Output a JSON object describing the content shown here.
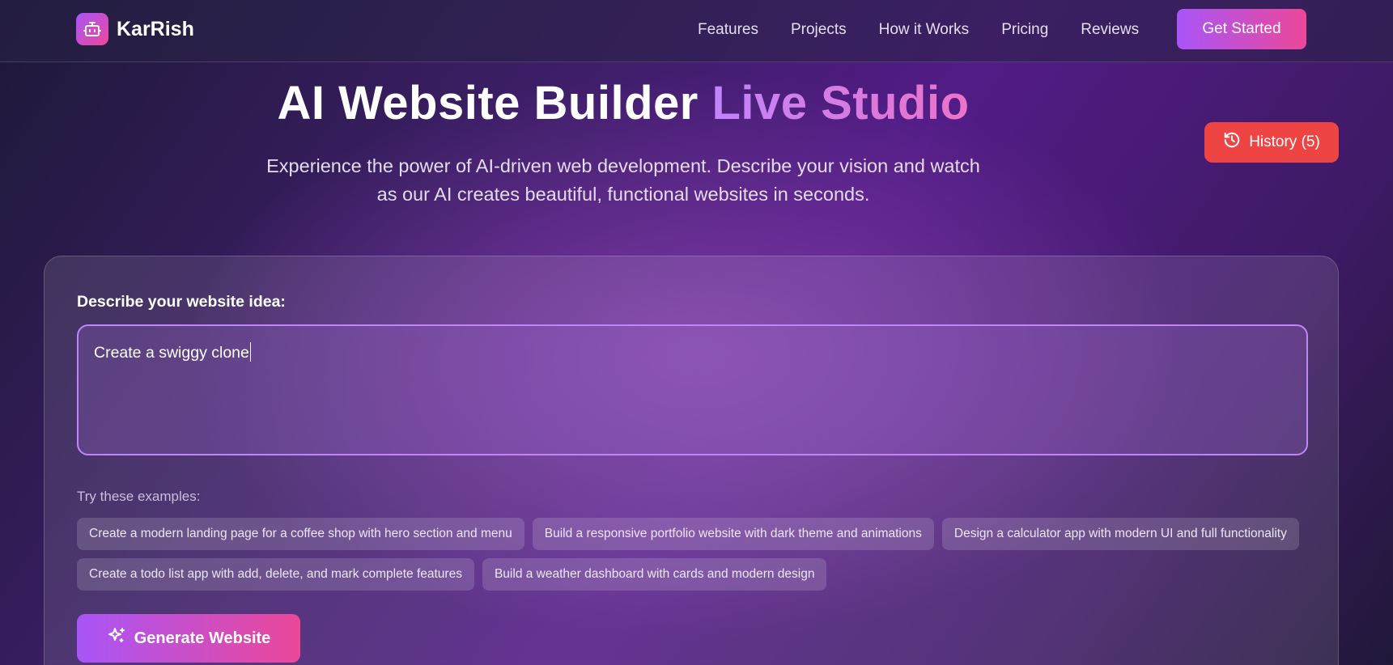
{
  "brand": {
    "name": "KarRish",
    "icon": "robot-icon"
  },
  "nav": {
    "links": [
      "Features",
      "Projects",
      "How it Works",
      "Pricing",
      "Reviews"
    ],
    "cta_label": "Get Started"
  },
  "hero": {
    "title_main": "AI Website Builder",
    "title_accent": "Live Studio",
    "subtitle_line1": "Experience the power of AI-driven web development. Describe your vision and watch",
    "subtitle_line2": "as our AI creates beautiful, functional websites in seconds."
  },
  "history": {
    "label": "History (5)",
    "icon": "history-icon"
  },
  "builder": {
    "prompt_label": "Describe your website idea:",
    "prompt_value": "Create a swiggy clone",
    "examples_label": "Try these examples:",
    "examples": [
      "Create a modern landing page for a coffee shop with hero section and menu",
      "Build a responsive portfolio website with dark theme and animations",
      "Design a calculator app with modern UI and full functionality",
      "Create a todo list app with add, delete, and mark complete features",
      "Build a weather dashboard with cards and modern design"
    ],
    "generate_label": "Generate Website",
    "generate_icon": "sparkles-icon"
  },
  "colors": {
    "accent_start": "#a855f7",
    "accent_end": "#ec4899",
    "history_button": "#ef4444",
    "prompt_border": "#c084fc"
  }
}
